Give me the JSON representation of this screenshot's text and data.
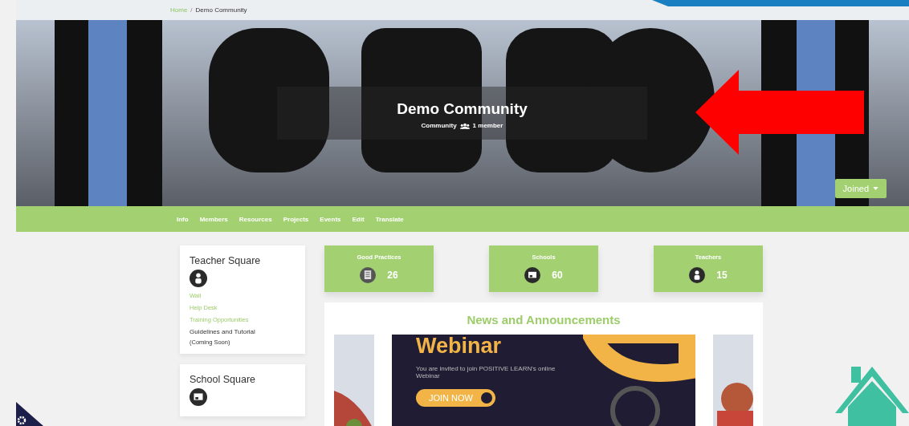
{
  "breadcrumb": [
    "Home",
    "/",
    "Demo Community"
  ],
  "community": {
    "title": "Demo Community",
    "type": "Community",
    "members": "1 member",
    "joined_button": "Joined"
  },
  "nav": [
    {
      "label": "Info"
    },
    {
      "label": "Members"
    },
    {
      "label": "Resources"
    },
    {
      "label": "Projects"
    },
    {
      "label": "Events"
    },
    {
      "label": "Edit"
    },
    {
      "label": "Translate"
    }
  ],
  "squares": [
    {
      "title": "Teacher Square",
      "links": [
        {
          "label": "Wall",
          "kind": "link"
        },
        {
          "label": "Help Desk",
          "kind": "link"
        },
        {
          "label": "Training Opportunities",
          "kind": "link"
        },
        {
          "label": "Guidelines and Tutorial",
          "kind": "text",
          "note": "(Coming Soon)"
        }
      ]
    },
    {
      "title": "School Square"
    }
  ],
  "stats": [
    {
      "label": "Good Practices",
      "count": "26"
    },
    {
      "label": "Schools",
      "count": "60"
    },
    {
      "label": "Teachers",
      "count": "15"
    }
  ],
  "news": {
    "title": "News and Announcements",
    "slide": {
      "heading": "Webinar",
      "text": "You are invited to join POSITIVE LEARN's online Webinar",
      "button": "JOIN NOW"
    }
  }
}
